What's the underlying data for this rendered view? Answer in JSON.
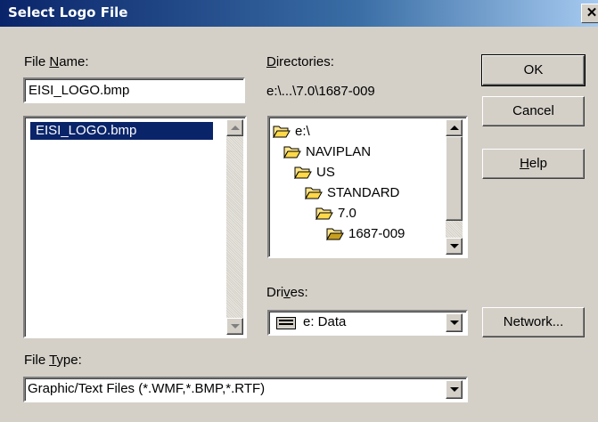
{
  "window": {
    "title": "Select Logo File",
    "close_glyph": "✕"
  },
  "file_name": {
    "label_pre": "File ",
    "label_key": "N",
    "label_post": "ame:",
    "value": "EISI_LOGO.bmp",
    "files": [
      "EISI_LOGO.bmp"
    ]
  },
  "directories": {
    "label_key": "D",
    "label_post": "irectories:",
    "current_path": "e:\\...\\7.0\\1687-009",
    "tree": [
      {
        "name": "e:\\",
        "icon": "open-folder-icon"
      },
      {
        "name": "NAVIPLAN",
        "icon": "open-folder-icon"
      },
      {
        "name": "US",
        "icon": "open-folder-icon"
      },
      {
        "name": "STANDARD",
        "icon": "open-folder-icon"
      },
      {
        "name": "7.0",
        "icon": "open-folder-icon"
      },
      {
        "name": "1687-009",
        "icon": "open-folder-icon"
      }
    ]
  },
  "drives": {
    "label_pre": "Dri",
    "label_key": "v",
    "label_post": "es:",
    "selected": "e: Data",
    "icon": "hard-drive-icon"
  },
  "file_type": {
    "label_pre": "File ",
    "label_key": "T",
    "label_post": "ype:",
    "selected": "Graphic/Text Files (*.WMF,*.BMP,*.RTF)"
  },
  "buttons": {
    "ok": "OK",
    "cancel": "Cancel",
    "help_key": "H",
    "help_post": "elp",
    "network": "Network..."
  }
}
